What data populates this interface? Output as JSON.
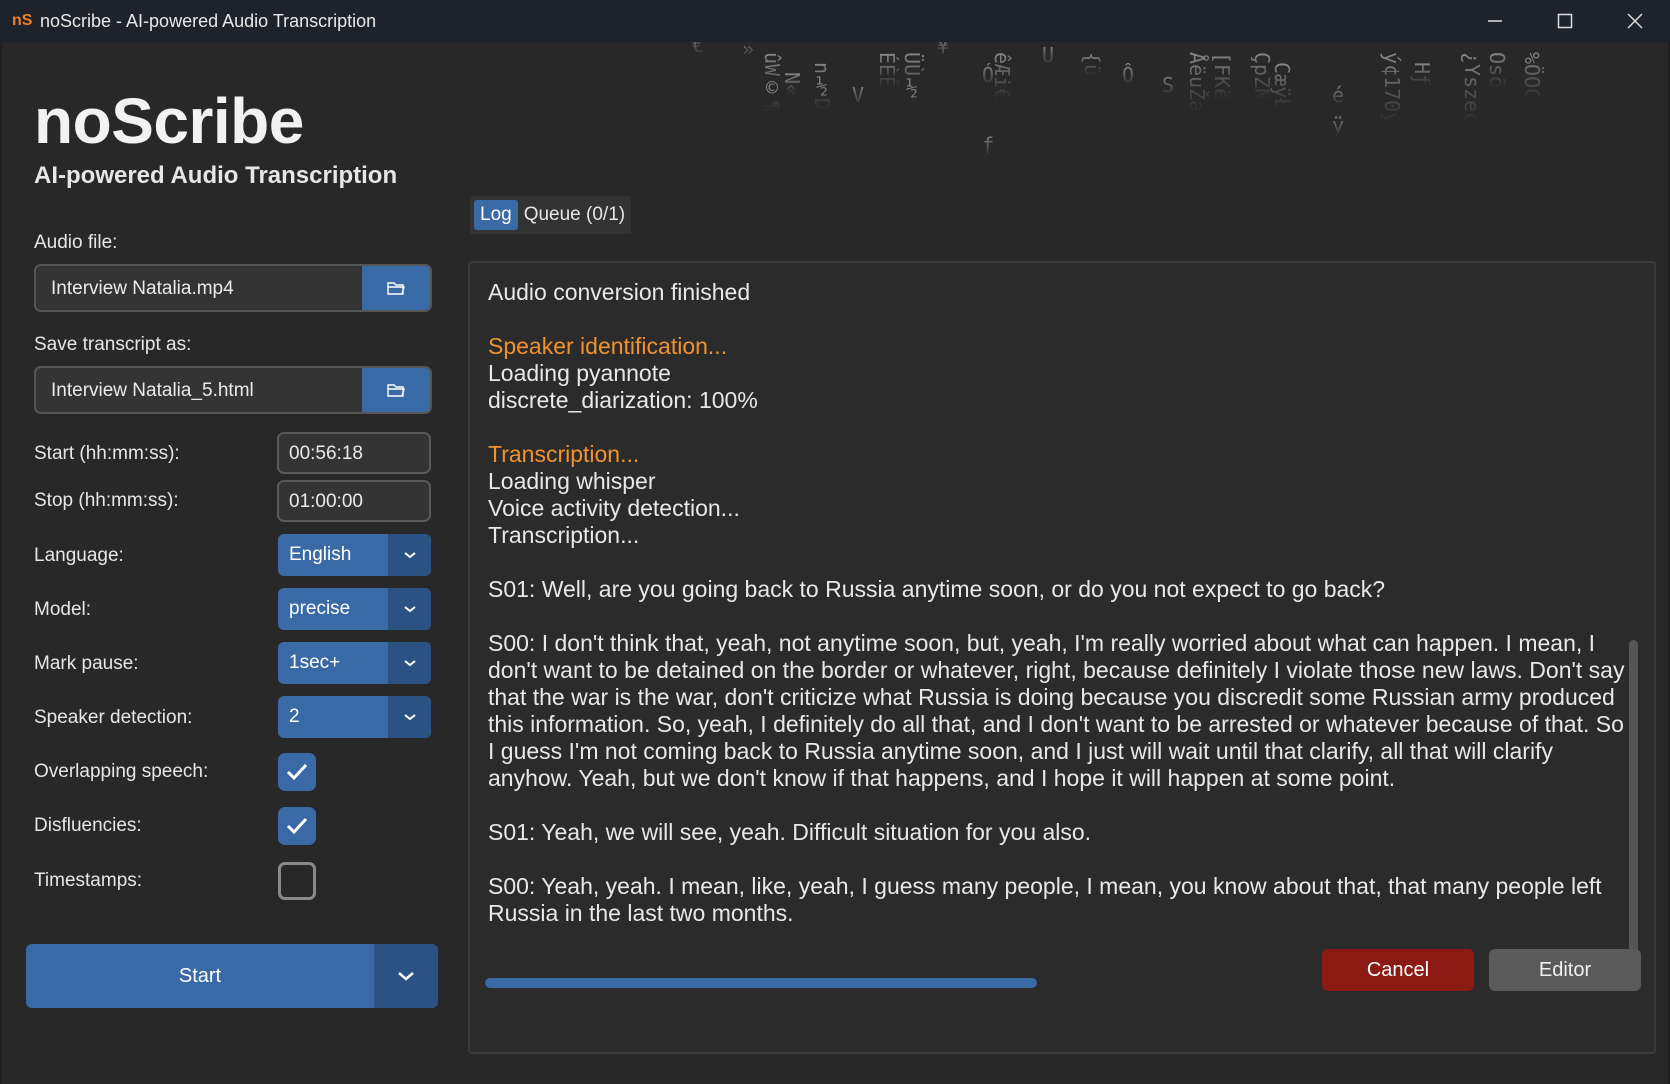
{
  "window": {
    "title": "noScribe - AI-powered Audio Transcription",
    "icon_text": "nS"
  },
  "header": {
    "app_name": "noScribe",
    "subtitle": "AI-powered Audio Transcription"
  },
  "settings": {
    "audio_file": {
      "label": "Audio file:",
      "value": "Interview Natalia.mp4",
      "icon": "folder-icon"
    },
    "save_transcript": {
      "label": "Save transcript as:",
      "value": "Interview Natalia_5.html",
      "icon": "folder-icon"
    },
    "start_time": {
      "label": "Start (hh:mm:ss):",
      "value": "00:56:18"
    },
    "stop_time": {
      "label": "Stop (hh:mm:ss):",
      "value": "01:00:00"
    },
    "language": {
      "label": "Language:",
      "value": "English"
    },
    "model": {
      "label": "Model:",
      "value": "precise"
    },
    "mark_pause": {
      "label": "Mark pause:",
      "value": "1sec+"
    },
    "speaker_detection": {
      "label": "Speaker detection:",
      "value": "2"
    },
    "overlapping_speech": {
      "label": "Overlapping speech:",
      "checked": true
    },
    "disfluencies": {
      "label": "Disfluencies:",
      "checked": true
    },
    "timestamps": {
      "label": "Timestamps:",
      "checked": false
    },
    "start_button": "Start"
  },
  "tabs": [
    {
      "label": "Log",
      "active": true
    },
    {
      "label": "Queue (0/1)",
      "active": false
    }
  ],
  "log": {
    "lines": [
      {
        "text": "Audio conversion finished",
        "style": "normal"
      },
      {
        "text": "",
        "style": "gap"
      },
      {
        "text": "Speaker identification...",
        "style": "orange"
      },
      {
        "text": "Loading pyannote",
        "style": "normal"
      },
      {
        "text": "discrete_diarization: 100%",
        "style": "normal"
      },
      {
        "text": "",
        "style": "gap"
      },
      {
        "text": "Transcription...",
        "style": "orange"
      },
      {
        "text": "Loading whisper",
        "style": "normal"
      },
      {
        "text": "Voice activity detection...",
        "style": "normal"
      },
      {
        "text": "Transcription...",
        "style": "normal"
      },
      {
        "text": "",
        "style": "gap"
      },
      {
        "text": "S01: Well, are you going back to Russia anytime soon, or do you not expect to go back?",
        "style": "normal"
      },
      {
        "text": "",
        "style": "gap"
      },
      {
        "text": "S00: I don't think that, yeah, not anytime soon, but, yeah, I'm really worried about what can happen. I mean, I don't want to be detained on the border or whatever, right, because definitely I violate those new laws. Don't say that the war is the war, don't criticize what Russia is doing because you discredit some Russian army produced this information. So, yeah, I definitely do all that, and I don't want to be arrested or whatever because of that. So I guess I'm not coming back to Russia anytime soon, and I just will wait until that clarify, all that will clarify anyhow. Yeah, but we don't know if that happens, and I hope it will happen at some point.",
        "style": "normal"
      },
      {
        "text": "",
        "style": "gap"
      },
      {
        "text": "S01: Yeah, we will see, yeah. Difficult situation for you also.",
        "style": "normal"
      },
      {
        "text": "",
        "style": "gap"
      },
      {
        "text": "S00: Yeah, yeah. I mean, like, yeah, I guess many people, I mean, you know about that, that many people left Russia in the last two months.",
        "style": "normal"
      }
    ]
  },
  "progress": 0.48,
  "buttons": {
    "cancel": "Cancel",
    "editor": "Editor"
  },
  "colors": {
    "accent": "#3a6aa6",
    "accent_dark": "#2c5183",
    "highlight": "#f0922e",
    "cancel": "#8b1a14",
    "background": "#282828"
  }
}
